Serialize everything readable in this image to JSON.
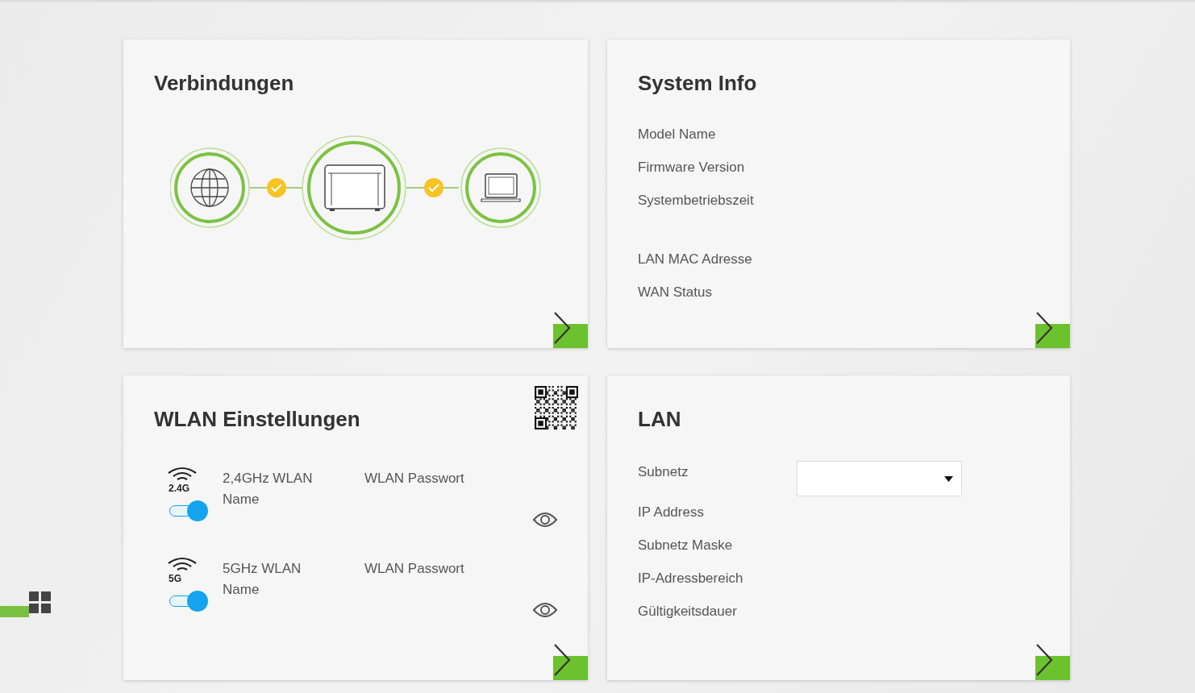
{
  "connections": {
    "title": "Verbindungen",
    "links": [
      {
        "connected": true
      },
      {
        "connected": true
      }
    ]
  },
  "system_info": {
    "title": "System Info",
    "groups": [
      [
        "Model Name",
        "Firmware Version",
        "Systembetriebszeit"
      ],
      [
        "LAN MAC Adresse",
        "WAN Status"
      ]
    ]
  },
  "wlan": {
    "title": "WLAN Einstellungen",
    "bands": [
      {
        "badge": "2.4G",
        "name_label": "2,4GHz WLAN Name",
        "password_label": "WLAN Passwort",
        "on": true
      },
      {
        "badge": "5G",
        "name_label": "5GHz WLAN Name",
        "password_label": "WLAN Passwort",
        "on": true
      }
    ]
  },
  "lan": {
    "title": "LAN",
    "subnet_label": "Subnetz",
    "fields": [
      "IP Address",
      "Subnetz Maske",
      "IP-Adressbereich",
      "Gültigkeitsdauer"
    ]
  }
}
